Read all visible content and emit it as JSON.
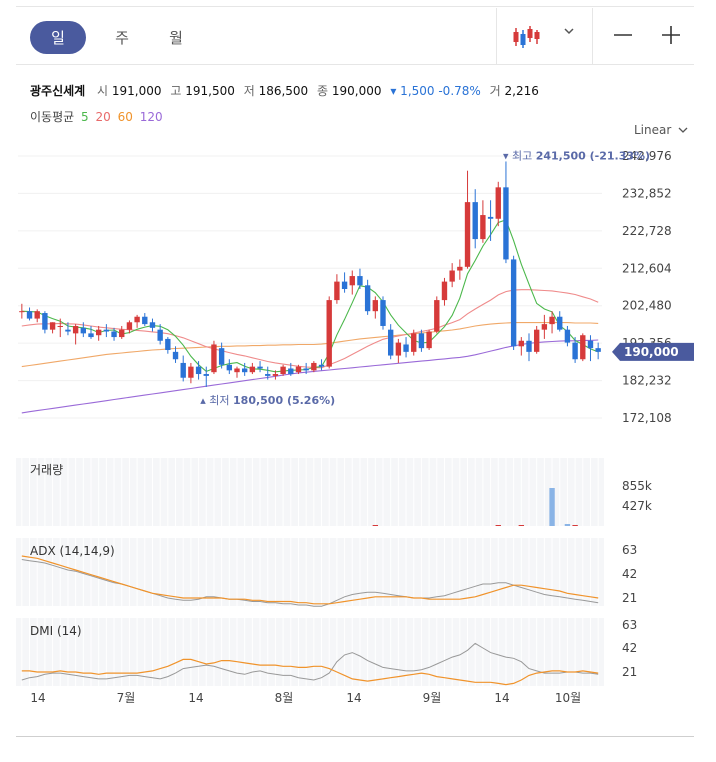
{
  "tabs": [
    {
      "label": "일",
      "active": true
    },
    {
      "label": "주",
      "active": false
    },
    {
      "label": "월",
      "active": false
    }
  ],
  "toolbar": {
    "chart_type_icon": "candlestick-icon",
    "dropdown_icon": "chevron-down-icon",
    "zoom_out_icon": "minus-icon",
    "zoom_in_icon": "plus-icon"
  },
  "quote": {
    "name": "광주신세계",
    "open_label": "시",
    "open": "191,000",
    "high_label": "고",
    "high": "191,500",
    "low_label": "저",
    "low": "186,500",
    "close_label": "종",
    "close": "190,000",
    "change": "▾ 1,500 -0.78%",
    "volume_label": "거",
    "volume": "2,216"
  },
  "ma": {
    "label": "이동평균",
    "p5": "5",
    "p20": "20",
    "p60": "60",
    "p120": "120"
  },
  "scale_mode": "Linear",
  "colors": {
    "up": "#d63a3a",
    "down": "#2a73d6",
    "ma5": "#4cb84c",
    "ma20": "#ef8b8b",
    "ma60": "#f0a868",
    "ma120": "#9a6ad8",
    "adx": "#f0932b",
    "adx_sub": "#999999",
    "accent": "#4a5a9e"
  },
  "chart_data": {
    "type": "candlestick",
    "price_axis": {
      "ticks": [
        "242,976",
        "232,852",
        "222,728",
        "212,604",
        "202,480",
        "192,356",
        "182,232",
        "172,108"
      ],
      "min": 172108,
      "max": 242976
    },
    "current_price": {
      "value": 190000,
      "label": "190,000"
    },
    "max_annotation": {
      "label": "▾ 최고",
      "value": "241,500 (-21.33%)",
      "price": 241500
    },
    "min_annotation": {
      "label": "▴ 최저",
      "value": "180,500 (5.26%)",
      "price": 180500
    },
    "x_ticks": [
      "14",
      "7월",
      "14",
      "8월",
      "14",
      "9월",
      "14",
      "10월"
    ],
    "candles": [
      [
        201000,
        203000,
        199000,
        201000
      ],
      [
        201000,
        202000,
        198500,
        199000
      ],
      [
        199000,
        201500,
        198000,
        201000
      ],
      [
        200500,
        201000,
        195000,
        196000
      ],
      [
        196000,
        198000,
        195000,
        198000
      ],
      [
        197000,
        199000,
        194000,
        197000
      ],
      [
        196000,
        198000,
        194500,
        195500
      ],
      [
        195000,
        197500,
        192000,
        197000
      ],
      [
        196500,
        198000,
        194000,
        195000
      ],
      [
        195000,
        197000,
        193500,
        194000
      ],
      [
        194500,
        197000,
        193000,
        196000
      ],
      [
        196000,
        197500,
        194000,
        195500
      ],
      [
        195500,
        196500,
        193000,
        194000
      ],
      [
        194000,
        197000,
        193500,
        196000
      ],
      [
        196000,
        198500,
        195000,
        198000
      ],
      [
        198000,
        200000,
        196500,
        199500
      ],
      [
        199500,
        200500,
        197000,
        197500
      ],
      [
        198000,
        199000,
        195500,
        196500
      ],
      [
        196000,
        197500,
        192000,
        193000
      ],
      [
        193500,
        194000,
        189500,
        190500
      ],
      [
        190000,
        191500,
        187000,
        188000
      ],
      [
        187000,
        189000,
        182000,
        183000
      ],
      [
        183000,
        187000,
        181500,
        186000
      ],
      [
        186000,
        187500,
        182500,
        184000
      ],
      [
        184000,
        186000,
        180500,
        183500
      ],
      [
        184500,
        193000,
        184000,
        192000
      ],
      [
        191000,
        192500,
        185500,
        186500
      ],
      [
        186500,
        188000,
        184000,
        185000
      ],
      [
        184500,
        186000,
        183000,
        185500
      ],
      [
        185500,
        187000,
        183500,
        184500
      ],
      [
        184500,
        187000,
        184000,
        186000
      ],
      [
        186000,
        187500,
        184500,
        185500
      ],
      [
        184000,
        186000,
        182500,
        183500
      ],
      [
        183500,
        185000,
        182500,
        184000
      ],
      [
        184000,
        186500,
        183500,
        186000
      ],
      [
        185500,
        187000,
        183500,
        184000
      ],
      [
        184500,
        186500,
        184000,
        186000
      ],
      [
        185500,
        187000,
        184000,
        185000
      ],
      [
        185000,
        187500,
        184500,
        187000
      ],
      [
        186500,
        188000,
        185000,
        186000
      ],
      [
        186000,
        205000,
        185500,
        204000
      ],
      [
        204000,
        211000,
        203000,
        209000
      ],
      [
        209000,
        211500,
        206000,
        207000
      ],
      [
        208000,
        212000,
        205500,
        210500
      ],
      [
        210500,
        212500,
        207000,
        208000
      ],
      [
        208000,
        209500,
        200000,
        201000
      ],
      [
        201000,
        205000,
        199000,
        204000
      ],
      [
        204000,
        205000,
        196000,
        197000
      ],
      [
        196000,
        197500,
        188000,
        189000
      ],
      [
        189000,
        193500,
        187000,
        192500
      ],
      [
        192000,
        194000,
        188500,
        190000
      ],
      [
        190000,
        196000,
        189000,
        195000
      ],
      [
        195000,
        196000,
        190000,
        191000
      ],
      [
        191000,
        196000,
        190500,
        195500
      ],
      [
        195500,
        205000,
        195000,
        204000
      ],
      [
        204000,
        210000,
        202500,
        209000
      ],
      [
        209000,
        214000,
        207500,
        212000
      ],
      [
        212000,
        215000,
        209500,
        213000
      ],
      [
        213000,
        239000,
        212500,
        230500
      ],
      [
        230500,
        234000,
        218000,
        220500
      ],
      [
        220500,
        231000,
        219500,
        227000
      ],
      [
        226500,
        231000,
        220000,
        226000
      ],
      [
        226000,
        236000,
        224000,
        234500
      ],
      [
        234500,
        241500,
        214000,
        215000
      ],
      [
        215000,
        216000,
        190500,
        191500
      ],
      [
        191500,
        194000,
        189000,
        193000
      ],
      [
        193000,
        195000,
        187500,
        190000
      ],
      [
        190000,
        197000,
        189500,
        196000
      ],
      [
        196000,
        200000,
        193500,
        197500
      ],
      [
        197500,
        201000,
        195000,
        199500
      ],
      [
        199500,
        201000,
        195500,
        196000
      ],
      [
        196000,
        197000,
        191500,
        192500
      ],
      [
        192500,
        194000,
        187000,
        188000
      ],
      [
        188000,
        195000,
        187500,
        194500
      ],
      [
        193000,
        194500,
        187500,
        191000
      ],
      [
        191000,
        192500,
        188000,
        190000
      ]
    ],
    "ma5": [
      201000,
      200900,
      200800,
      199800,
      199000,
      198300,
      197000,
      196700,
      196500,
      196100,
      195200,
      195800,
      195900,
      194800,
      195200,
      196100,
      196700,
      197100,
      196900,
      196000,
      194200,
      191800,
      188800,
      186500,
      184700,
      185500,
      186300,
      186800,
      187100,
      186100,
      185400,
      185300,
      185000,
      184600,
      184800,
      185000,
      185100,
      185200,
      185800,
      186000,
      189600,
      194600,
      198800,
      203300,
      207900,
      207500,
      206000,
      203500,
      200000,
      197200,
      195100,
      193100,
      192400,
      192600,
      194700,
      196800,
      199900,
      204500,
      211100,
      214700,
      218600,
      221700,
      225000,
      225700,
      220100,
      213700,
      208300,
      203100,
      201600,
      200800,
      197100,
      195500,
      193100,
      192000,
      190800,
      190000
    ],
    "ma20": [
      197000,
      197300,
      197500,
      197600,
      197600,
      197700,
      197600,
      197500,
      197300,
      197000,
      196700,
      196500,
      196300,
      196100,
      196000,
      195800,
      195600,
      195400,
      195200,
      194900,
      194400,
      193800,
      193000,
      192200,
      191400,
      190800,
      190300,
      189800,
      189300,
      188900,
      188400,
      187900,
      187400,
      187000,
      186700,
      186400,
      186100,
      185900,
      185800,
      185700,
      186500,
      187300,
      188200,
      189300,
      190400,
      191500,
      192500,
      193400,
      193900,
      194300,
      194700,
      195100,
      195500,
      195900,
      196400,
      197200,
      197900,
      198700,
      200300,
      201600,
      202800,
      204000,
      205400,
      206300,
      206700,
      206800,
      206800,
      206700,
      206600,
      206500,
      206200,
      205900,
      205500,
      204900,
      204300,
      203400
    ],
    "ma60": [
      186000,
      186300,
      186600,
      186900,
      187200,
      187500,
      187800,
      188100,
      188400,
      188700,
      189000,
      189300,
      189500,
      189700,
      189900,
      190100,
      190300,
      190500,
      190600,
      190800,
      190900,
      191000,
      191100,
      191200,
      191300,
      191400,
      191500,
      191500,
      191600,
      191600,
      191700,
      191700,
      191800,
      191800,
      191900,
      191900,
      192000,
      192000,
      192000,
      192100,
      192300,
      192600,
      192900,
      193200,
      193500,
      193700,
      193900,
      194100,
      194300,
      194500,
      194700,
      194900,
      195100,
      195300,
      195500,
      195700,
      195900,
      196200,
      196600,
      197000,
      197300,
      197500,
      197700,
      197800,
      197900,
      197900,
      197900,
      197900,
      197900,
      197900,
      197900,
      197900,
      197800,
      197800,
      197800,
      197700
    ],
    "ma120": [
      173500,
      173800,
      174100,
      174400,
      174700,
      175000,
      175300,
      175600,
      175900,
      176200,
      176500,
      176800,
      177100,
      177400,
      177700,
      178000,
      178300,
      178600,
      178900,
      179200,
      179500,
      179800,
      180100,
      180400,
      180700,
      181000,
      181300,
      181600,
      181900,
      182200,
      182500,
      182800,
      183100,
      183400,
      183700,
      184000,
      184300,
      184500,
      184700,
      184900,
      185100,
      185300,
      185500,
      185700,
      185900,
      186100,
      186300,
      186500,
      186700,
      186900,
      187100,
      187300,
      187500,
      187700,
      187900,
      188100,
      188300,
      188500,
      188800,
      189200,
      189700,
      190200,
      190700,
      191200,
      191600,
      192000,
      192300,
      192500,
      192700,
      192800,
      192900,
      193000,
      193000,
      193100,
      193100,
      193200
    ],
    "volume": {
      "label": "거래량",
      "ticks": [
        "855k",
        "427k"
      ],
      "max": 855000
    },
    "adx": {
      "label": "ADX (14,14,9)",
      "ticks": [
        "63",
        "42",
        "21"
      ],
      "adx": [
        57,
        56,
        55,
        53,
        51,
        49,
        47,
        45,
        43,
        41,
        39,
        37,
        35,
        33,
        31,
        29,
        27,
        25,
        24,
        23,
        22,
        21,
        21,
        21,
        21,
        21,
        21,
        20,
        20,
        20,
        19,
        19,
        18,
        18,
        18,
        18,
        17,
        17,
        16,
        16,
        16,
        17,
        18,
        19,
        20,
        21,
        22,
        22,
        22,
        22,
        22,
        21,
        21,
        20,
        20,
        20,
        20,
        20,
        21,
        22,
        24,
        26,
        28,
        30,
        32,
        32,
        31,
        30,
        29,
        28,
        27,
        25,
        24,
        23,
        22,
        21
      ],
      "signal": [
        54,
        53,
        52,
        51,
        49,
        47,
        45,
        44,
        42,
        40,
        38,
        36,
        34,
        33,
        31,
        29,
        27,
        25,
        23,
        21,
        20,
        19,
        19,
        20,
        22,
        22,
        21,
        20,
        20,
        19,
        18,
        18,
        17,
        17,
        16,
        16,
        15,
        15,
        14,
        14,
        16,
        19,
        22,
        24,
        25,
        26,
        26,
        25,
        24,
        23,
        22,
        21,
        21,
        21,
        22,
        23,
        25,
        27,
        29,
        31,
        33,
        33,
        34,
        34,
        32,
        30,
        28,
        26,
        24,
        23,
        22,
        21,
        20,
        19,
        18,
        17
      ]
    },
    "dmi": {
      "label": "DMI (14)",
      "ticks": [
        "63",
        "42",
        "21"
      ],
      "pdi": [
        14,
        16,
        17,
        19,
        20,
        20,
        19,
        18,
        17,
        16,
        15,
        15,
        16,
        17,
        18,
        18,
        17,
        16,
        15,
        17,
        20,
        24,
        25,
        26,
        27,
        26,
        24,
        22,
        20,
        19,
        21,
        22,
        20,
        19,
        18,
        18,
        16,
        15,
        14,
        16,
        20,
        30,
        36,
        38,
        35,
        31,
        28,
        25,
        24,
        23,
        22,
        22,
        23,
        25,
        28,
        31,
        34,
        36,
        40,
        46,
        42,
        38,
        36,
        34,
        33,
        30,
        24,
        22,
        20,
        20,
        20,
        21,
        21,
        20,
        20,
        19
      ],
      "mdi": [
        22,
        22,
        21,
        21,
        21,
        22,
        21,
        21,
        20,
        20,
        19,
        20,
        20,
        20,
        20,
        20,
        21,
        22,
        24,
        26,
        29,
        32,
        32,
        30,
        28,
        29,
        31,
        31,
        30,
        29,
        28,
        27,
        27,
        27,
        26,
        26,
        25,
        25,
        26,
        26,
        24,
        21,
        18,
        15,
        14,
        13,
        14,
        15,
        16,
        17,
        18,
        19,
        20,
        19,
        17,
        16,
        15,
        14,
        13,
        12,
        12,
        12,
        11,
        10,
        11,
        14,
        18,
        20,
        21,
        22,
        22,
        21,
        21,
        22,
        21,
        20
      ]
    }
  }
}
